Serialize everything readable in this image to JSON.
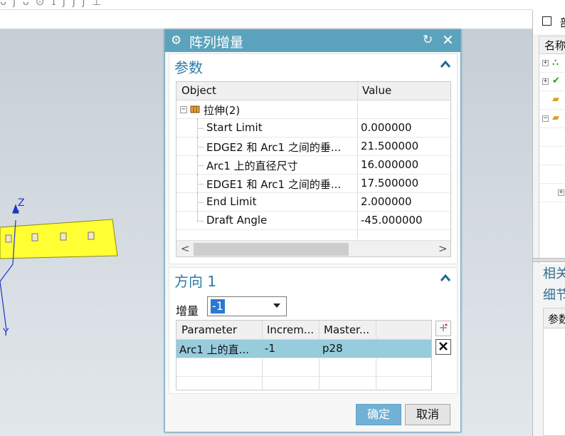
{
  "top_bar": {
    "glyphs": "ᴗ ʃ ᴗ ⊙ ɿ ʃ ʃ ʃ  ⊥"
  },
  "viewport": {
    "axis_z": "Z",
    "axis_y": "Y",
    "colors": {
      "part": "#ffff33",
      "axis": "#2233cc"
    }
  },
  "dialog": {
    "title": "阵列增量",
    "gear_icon": "⚙",
    "reset_icon": "↻",
    "close_icon": "✕",
    "params_section": {
      "title": "参数",
      "columns": [
        "Object",
        "Value"
      ],
      "root": {
        "label": "拉伸(2)"
      },
      "rows": [
        {
          "name": "Start Limit",
          "value": "0.000000"
        },
        {
          "name": "EDGE2 和 Arc1 之间的垂...",
          "value": "21.500000"
        },
        {
          "name": "Arc1 上的直径尺寸",
          "value": "16.000000"
        },
        {
          "name": "EDGE1 和 Arc1 之间的垂...",
          "value": "17.500000"
        },
        {
          "name": "End Limit",
          "value": "2.000000"
        },
        {
          "name": "Draft Angle",
          "value": "-45.000000"
        }
      ],
      "scroll_left": "<",
      "scroll_right": ">"
    },
    "direction_section": {
      "title": "方向 1",
      "increment_label": "增量",
      "increment_value": "-1",
      "columns": [
        "Parameter",
        "Increm...",
        "Master..."
      ],
      "rows": [
        {
          "parameter": "Arc1 上的直...",
          "increment": "-1",
          "master": "p28"
        }
      ]
    },
    "ok_label": "确定",
    "cancel_label": "取消",
    "accent_color": "#5ba3bc"
  },
  "right_panel": {
    "title_partial": "部",
    "column_partial": "名称",
    "section1_partial": "相关",
    "section2_partial": "细节",
    "details_header_partial": "参数"
  }
}
